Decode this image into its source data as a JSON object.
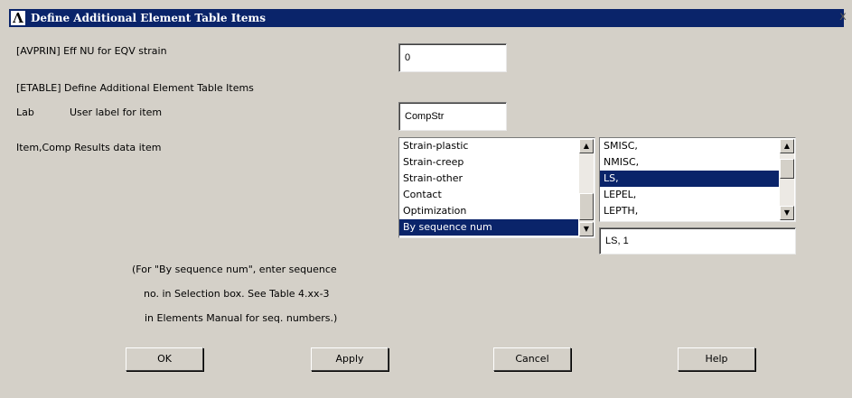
{
  "window": {
    "title": "Define Additional Element Table Items",
    "close_glyph": "x"
  },
  "avprin": {
    "label": "[AVPRIN]  Eff NU for EQV strain",
    "value": "0"
  },
  "etable": {
    "label": "[ETABLE]  Define Additional Element Table Items"
  },
  "lab": {
    "key": "Lab",
    "label": "User label for item",
    "value": "CompStr"
  },
  "itemcomp": {
    "label": "Item,Comp  Results data item",
    "items": [
      "Strain-plastic",
      "Strain-creep",
      "Strain-other",
      "Contact",
      "Optimization",
      "By sequence num"
    ],
    "selected_item": "By sequence num",
    "comps": [
      "SMISC,",
      "NMISC,",
      "LS,",
      "LEPEL,",
      "LEPTH,"
    ],
    "selected_comp": "LS,",
    "selection_value": "LS, 1"
  },
  "note": {
    "line1": "(For \"By sequence num\", enter sequence",
    "line2": "no. in Selection box.  See Table 4.xx-3",
    "line3": "in Elements Manual for seq. numbers.)"
  },
  "buttons": {
    "ok": "OK",
    "apply": "Apply",
    "cancel": "Cancel",
    "help": "Help"
  },
  "colors": {
    "dialog_bg": "#d4d0c8",
    "titlebar": "#0a246a",
    "selection": "#0a246a"
  }
}
